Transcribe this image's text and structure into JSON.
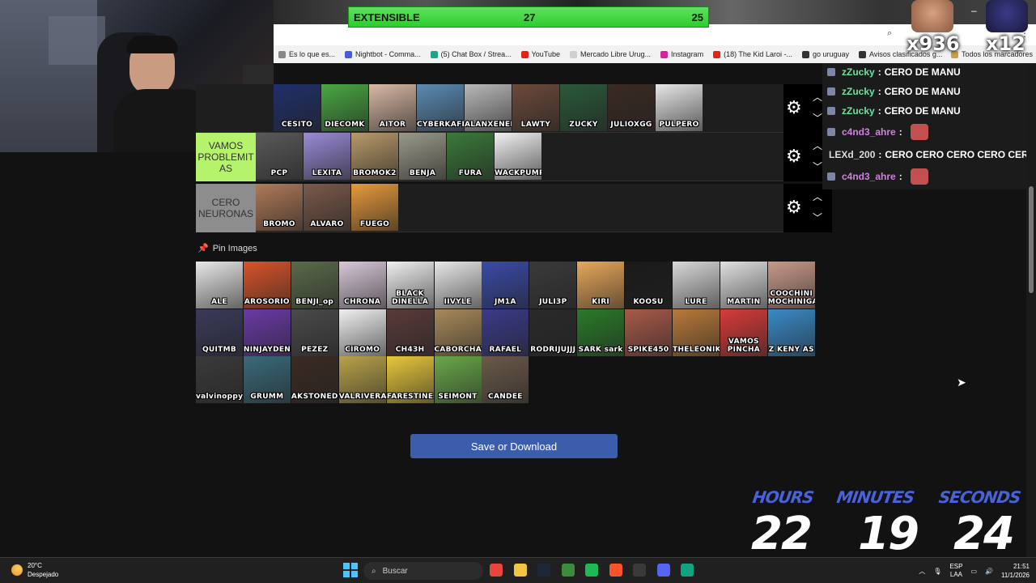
{
  "overlay": {
    "extensible": {
      "label": "EXTENSIBLE",
      "left_value": "27",
      "right_value": "25"
    },
    "multipliers": [
      "x936",
      "x12"
    ]
  },
  "bookmarks": [
    {
      "label": "Es lo que es...",
      "icon": "page-icon",
      "color": "#888888"
    },
    {
      "label": "Nightbot - Comma...",
      "icon": "nightbot-icon",
      "color": "#4b5bd8"
    },
    {
      "label": "(5) Chat Box / Strea...",
      "icon": "streamelements-icon",
      "color": "#1fa38a"
    },
    {
      "label": "YouTube",
      "icon": "youtube-icon",
      "color": "#e62117"
    },
    {
      "label": "Mercado Libre Urug...",
      "icon": "mercadolibre-icon",
      "color": "#cfcfcf"
    },
    {
      "label": "Instagram",
      "icon": "instagram-icon",
      "color": "#d6249f"
    },
    {
      "label": "(18) The Kid Laroi -...",
      "icon": "youtube-icon",
      "color": "#e62117"
    },
    {
      "label": "go uruguay",
      "icon": "globe-icon",
      "color": "#333333"
    },
    {
      "label": "Avisos clasificados g...",
      "icon": "globe-icon",
      "color": "#333333"
    }
  ],
  "bookmarks_right": "Todos los marcadores",
  "tiers": [
    {
      "label": "",
      "label_color": "#1e1e1e",
      "tiles": [
        {
          "name": "CESITO",
          "color": "#1f2f6a"
        },
        {
          "name": "DIECOMK",
          "color": "#4aa843"
        },
        {
          "name": "AITOR",
          "color": "#d9b9a5"
        },
        {
          "name": "CYBERKAFEH",
          "color": "#5b8bb3"
        },
        {
          "name": "ALANXENEIZE",
          "color": "#b9b9b9"
        },
        {
          "name": "LAWTY",
          "color": "#6b4a3a"
        },
        {
          "name": "ZUCKY",
          "color": "#2a5a3a"
        },
        {
          "name": "JULIOXGG",
          "color": "#3a2a22"
        },
        {
          "name": "PULPERO",
          "color": "#e7e7e7"
        }
      ]
    },
    {
      "label": "VAMOS PROBLEMIT AS",
      "label_color": "#b6f36d",
      "tiles": [
        {
          "name": "PCP",
          "color": "#5a5a5a"
        },
        {
          "name": "LEXITA",
          "color": "#9a8bd8"
        },
        {
          "name": "BROMOK2",
          "color": "#b89a6a"
        },
        {
          "name": "BENJA",
          "color": "#9a9a8a"
        },
        {
          "name": "FURA",
          "color": "#3a7a3a"
        },
        {
          "name": "WACKPUMPKIN",
          "color": "#f2f2f2"
        }
      ]
    },
    {
      "label": "CERO NEURONAS",
      "label_color": "#8d8d8d",
      "tiles": [
        {
          "name": "BROMO",
          "color": "#b07a5a"
        },
        {
          "name": "ALVARO",
          "color": "#7a5a4a"
        },
        {
          "name": "FUEGO",
          "color": "#e89a3a"
        }
      ]
    }
  ],
  "pin_images": {
    "heading": "Pin Images",
    "tiles": [
      {
        "name": "ALE",
        "color": "#e8e8e8"
      },
      {
        "name": "AROSORIO",
        "color": "#d8532a"
      },
      {
        "name": "BENJI_op",
        "color": "#5a6a4a"
      },
      {
        "name": "CHRONA",
        "color": "#d8c8d8"
      },
      {
        "name": "BLACK DINELLA",
        "color": "#f0f0f0"
      },
      {
        "name": "IIVYLE",
        "color": "#e8e8e8"
      },
      {
        "name": "JM1A",
        "color": "#3a4aa8"
      },
      {
        "name": "JULI3P",
        "color": "#3a3a3a"
      },
      {
        "name": "KIRI",
        "color": "#e8a85a"
      },
      {
        "name": "KOOSU",
        "color": "#1a1a1a"
      },
      {
        "name": "LURE",
        "color": "#d8d8d8"
      },
      {
        "name": "MARTIN",
        "color": "#e0e0e0"
      },
      {
        "name": "COOCHINI MOCHINIGAY",
        "color": "#c89a8a"
      },
      {
        "name": "QUITMB",
        "color": "#3a3a5a"
      },
      {
        "name": "NINJAYDEN",
        "color": "#6a3aa8"
      },
      {
        "name": "PEZEZ",
        "color": "#4a4a4a"
      },
      {
        "name": "CIROMO",
        "color": "#f0f0f0"
      },
      {
        "name": "CH43H",
        "color": "#5a3a3a"
      },
      {
        "name": "CABORCHATA",
        "color": "#a88a5a"
      },
      {
        "name": "RAFAEL",
        "color": "#3a3a8a"
      },
      {
        "name": "RODRIJUJJJ",
        "color": "#2a2a2a"
      },
      {
        "name": "SARK sark",
        "color": "#2a7a2a"
      },
      {
        "name": "SPIKE450",
        "color": "#a85a4a"
      },
      {
        "name": "THELEONIKI",
        "color": "#b87a3a"
      },
      {
        "name": "VAMOS PINCHA",
        "color": "#d83a3a"
      },
      {
        "name": "Z KENY AS",
        "color": "#3a8ac8"
      },
      {
        "name": "valvinoppy",
        "color": "#3a3a3a"
      },
      {
        "name": "GRUMM",
        "color": "#3a6a7a"
      },
      {
        "name": "AKSTONED",
        "color": "#3a2a22"
      },
      {
        "name": "VALRIVERA",
        "color": "#b8a24a"
      },
      {
        "name": "FARESTINE",
        "color": "#e8c83a"
      },
      {
        "name": "SEIMONT",
        "color": "#6aa84a"
      },
      {
        "name": "CANDEE",
        "color": "#6a5a4a"
      }
    ]
  },
  "save_button": "Save or Download",
  "chat": [
    {
      "user": "zZucky",
      "sep": ":",
      "message": "CERO DE MANU",
      "badge": true,
      "style": "user",
      "emote": false
    },
    {
      "user": "zZucky",
      "sep": ":",
      "message": "CERO DE MANU",
      "badge": true,
      "style": "user",
      "emote": false
    },
    {
      "user": "zZucky",
      "sep": ":",
      "message": "CERO DE MANU",
      "badge": true,
      "style": "user",
      "emote": false
    },
    {
      "user": "c4nd3_ahre",
      "sep": ":",
      "message": "",
      "badge": true,
      "style": "user2",
      "emote": true
    },
    {
      "user": "LEXd_200",
      "sep": ":",
      "message": "CERO CERO CERO CERO CERL",
      "badge": false,
      "style": "user3",
      "emote": false
    },
    {
      "user": "c4nd3_ahre",
      "sep": ":",
      "message": "",
      "badge": true,
      "style": "user2",
      "emote": true
    }
  ],
  "timer": {
    "hours_label": "HOURS",
    "hours": "22",
    "minutes_label": "MINUTES",
    "minutes": "19",
    "seconds_label": "SECONDS",
    "seconds": "24"
  },
  "taskbar": {
    "temperature": "20°C",
    "weather": "Despejado",
    "search_placeholder": "Buscar",
    "lang_1": "ESP",
    "lang_2": "LAA",
    "time": "21:51",
    "date": "11/1/2026",
    "apps": [
      {
        "icon": "chrome-icon",
        "color": "#e8453c"
      },
      {
        "icon": "file-explorer-icon",
        "color": "#f4c542"
      },
      {
        "icon": "steam-icon",
        "color": "#1b2838"
      },
      {
        "icon": "minecraft-icon",
        "color": "#3c8c3c"
      },
      {
        "icon": "spotify-icon",
        "color": "#1db954"
      },
      {
        "icon": "brave-icon",
        "color": "#fb542b"
      },
      {
        "icon": "obs-icon",
        "color": "#3a3a3a"
      },
      {
        "icon": "discord-icon",
        "color": "#5865f2"
      },
      {
        "icon": "chatgpt-icon",
        "color": "#10a37f"
      }
    ]
  }
}
